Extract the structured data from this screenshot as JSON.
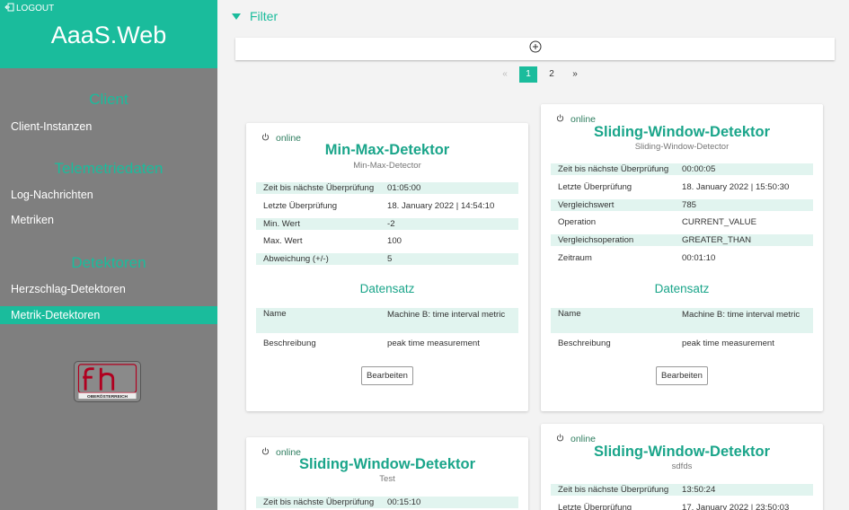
{
  "sidebar": {
    "logout_label": "LOGOUT",
    "app_title": "AaaS.Web",
    "sections": [
      {
        "title": "Client",
        "items": [
          "Client-Instanzen"
        ]
      },
      {
        "title": "Telemetriedaten",
        "items": [
          "Log-Nachrichten",
          "Metriken"
        ]
      },
      {
        "title": "Detektoren",
        "items": [
          "Herzschlag-Detektoren",
          "Metrik-Detektoren"
        ]
      }
    ],
    "active_item": "Metrik-Detektoren",
    "logo_text": "fh",
    "logo_subtext": "OBERÖSTERREICH"
  },
  "filter": {
    "label": "Filter"
  },
  "pagination": {
    "prev": "«",
    "pages": [
      "1",
      "2"
    ],
    "current": "1",
    "next": "»"
  },
  "dataset_title": "Datensatz",
  "edit_label": "Bearbeiten",
  "status_online": "online",
  "cards": [
    {
      "title": "Min-Max-Detektor",
      "subtitle": "Min-Max-Detector",
      "rows": [
        {
          "k": "Zeit bis nächste Überprüfung",
          "v": "01:05:00"
        },
        {
          "k": "Letzte Überprüfung",
          "v": "18. January 2022 | 14:54:10"
        },
        {
          "k": "Min. Wert",
          "v": "-2"
        },
        {
          "k": "Max. Wert",
          "v": "100"
        },
        {
          "k": "Abweichung (+/-)",
          "v": "5"
        }
      ],
      "dataset": {
        "name_label": "Name",
        "name_value": "Machine B: time interval metric",
        "desc_label": "Beschreibung",
        "desc_value": "peak time measurement"
      }
    },
    {
      "title": "Sliding-Window-Detektor",
      "subtitle": "Sliding-Window-Detector",
      "rows": [
        {
          "k": "Zeit bis nächste Überprüfung",
          "v": "00:00:05"
        },
        {
          "k": "Letzte Überprüfung",
          "v": "18. January 2022 | 15:50:30"
        },
        {
          "k": "Vergleichswert",
          "v": "785"
        },
        {
          "k": "Operation",
          "v": "CURRENT_VALUE"
        },
        {
          "k": "Vergleichsoperation",
          "v": "GREATER_THAN"
        },
        {
          "k": "Zeitraum",
          "v": "00:01:10"
        }
      ],
      "dataset": {
        "name_label": "Name",
        "name_value": "Machine B: time interval metric",
        "desc_label": "Beschreibung",
        "desc_value": "peak time measurement"
      }
    },
    {
      "title": "Sliding-Window-Detektor",
      "subtitle": "Test",
      "rows": [
        {
          "k": "Zeit bis nächste Überprüfung",
          "v": "00:15:10"
        }
      ]
    },
    {
      "title": "Sliding-Window-Detektor",
      "subtitle": "sdfds",
      "rows": [
        {
          "k": "Zeit bis nächste Überprüfung",
          "v": "13:50:24"
        },
        {
          "k": "Letzte Überprüfung",
          "v": "17. January 2022 | 23:50:03"
        }
      ]
    }
  ],
  "colors": {
    "accent": "#1abc9c",
    "sidebar": "#7f7f7f",
    "row_tint": "#e1f4ef"
  }
}
